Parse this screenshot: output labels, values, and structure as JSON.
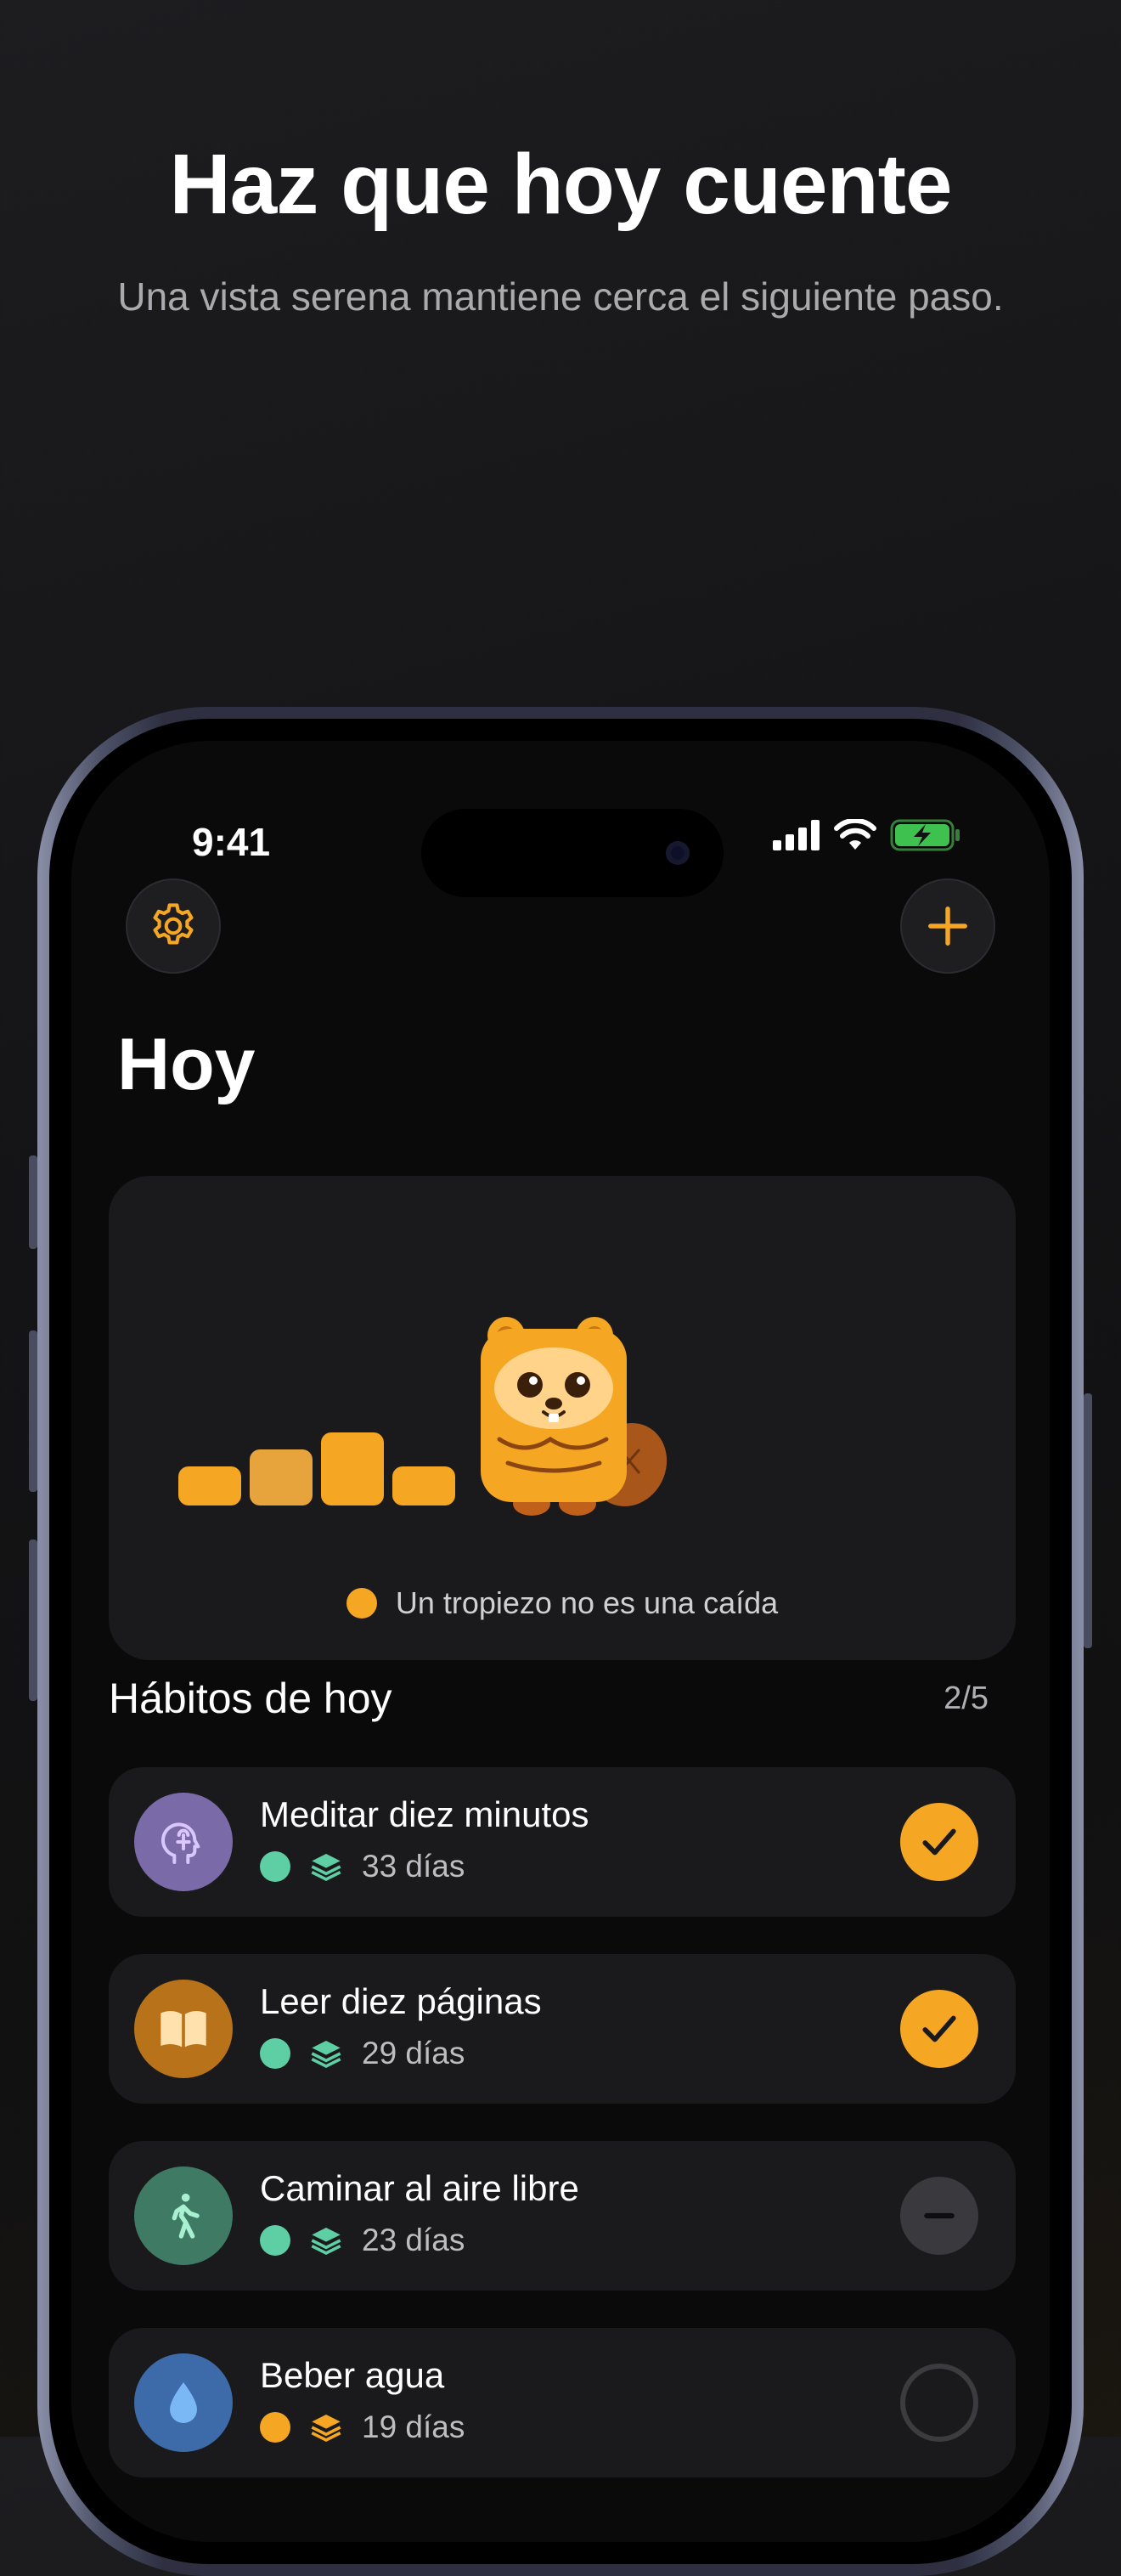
{
  "promo": {
    "headline": "Haz que hoy cuente",
    "subline": "Una vista serena mantiene cerca el siguiente paso."
  },
  "status_bar": {
    "time": "9:41"
  },
  "header": {
    "title": "Hoy"
  },
  "hero": {
    "caption": "Un tropiezo no es una caída",
    "caption_dot_color": "#f5a623"
  },
  "habits_section": {
    "title": "Hábitos de hoy",
    "count": "2/5"
  },
  "habits": [
    {
      "name": "Meditar diez minutos",
      "streak": "33 días",
      "icon": "brain-head-icon",
      "icon_color": "#7a6aa8",
      "status": "done"
    },
    {
      "name": "Leer diez páginas",
      "streak": "29 días",
      "icon": "open-book-icon",
      "icon_color": "#b8731a",
      "status": "done"
    },
    {
      "name": "Caminar al aire libre",
      "streak": "23 días",
      "icon": "walking-person-icon",
      "icon_color": "#3e7a64",
      "status": "skipped"
    },
    {
      "name": "Beber agua",
      "streak": "19 días",
      "icon": "water-drop-icon",
      "icon_color": "#3d6aa8",
      "status": "pending"
    }
  ],
  "colors": {
    "accent": "#f5a623",
    "streak_teal": "#5ecfa4",
    "streak_orange": "#f5a623",
    "card": "#1a1a1c"
  }
}
